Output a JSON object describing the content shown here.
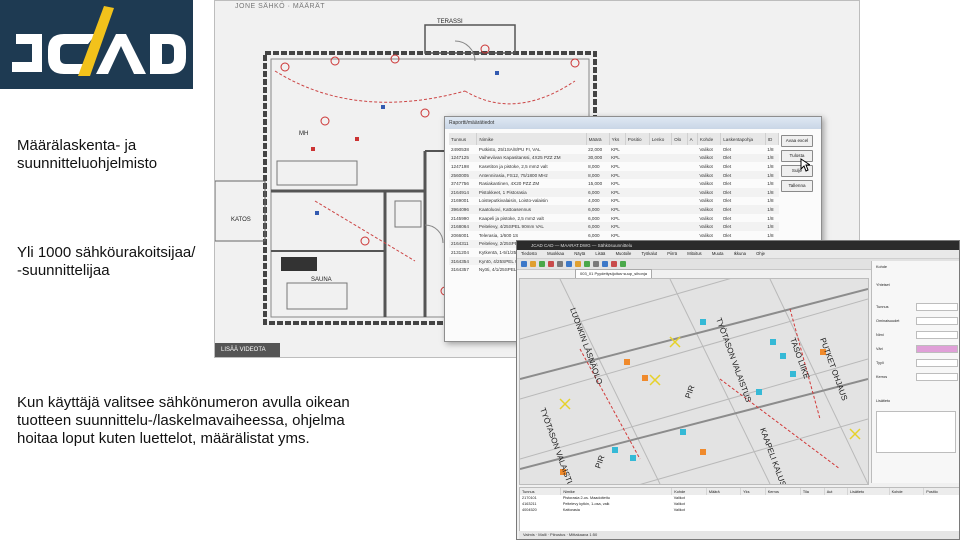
{
  "logo": {
    "text": "JCAD",
    "bg_color": "#1e3a52",
    "fg_color": "#ffffff"
  },
  "texts": {
    "line1": "Määrälaskenta- ja",
    "line2": "suunnitteluohjelmisto",
    "line3": "Yli 1000 sähköurakoitsijaa/",
    "line4": "-suunnittelijaa",
    "line5": "Kun käyttäjä valitsee sähkönumeron avulla oikean",
    "line6": "tuotteen suunnittelu-/laskelmavaiheessa, ohjelma",
    "line7": "hoitaa loput kuten luettelot, määrälistat yms."
  },
  "plan": {
    "title": "JONE SÄHKÖ · MÄÄRÄT",
    "rooms": [
      "TERASSI",
      "MH",
      "KATOS",
      "SAUNA"
    ],
    "bottom_label": "LISÄÄ VIDEOTA"
  },
  "report": {
    "title": "Raportti/määrätiedot",
    "columns": [
      "Tunnus",
      "Nimike",
      "Määrä",
      "Yks",
      "Positio",
      "Lenko",
      "Olo",
      "A",
      "Kohde",
      "Laskentapohja",
      "ID"
    ],
    "rows": [
      [
        "2490538",
        "Putkisto, 25/1SA/8/PU FI, VAL",
        "22,000",
        "KPL",
        "Valikot",
        "Olet",
        "1/8"
      ],
      [
        "1247125",
        "Vaiheviivan Kapasitanssi, 4X25 PZZ ZM",
        "30,000",
        "KPL",
        "Valikot",
        "Olet",
        "1/8"
      ],
      [
        "1247198",
        "Kasetiton ja pistoke, 2,5 mm2 valt",
        "8,000",
        "KPL",
        "Valikot",
        "Olet",
        "1/8"
      ],
      [
        "2560005",
        "Antennirasia, FS12, 75/1800 MHz",
        "8,000",
        "KPL",
        "Valikot",
        "Olet",
        "1/8"
      ],
      [
        "3747756",
        "Rasiakantinen, 4X20 PZZ ZM",
        "15,000",
        "KPL",
        "Valikot",
        "Olet",
        "1/8"
      ],
      [
        "2164914",
        "Pistokkeet, 1 Pistorasia",
        "6,000",
        "KPL",
        "Valikot",
        "Olet",
        "1/8"
      ],
      [
        "2169001",
        "Loisteputkivalaisin, Loisto-valaisin",
        "4,000",
        "KPL",
        "Valikot",
        "Olet",
        "1/8"
      ],
      [
        "3964096",
        "Kaatoluovi, Kattoasennus",
        "6,000",
        "KPL",
        "Valikot",
        "Olet",
        "1/8"
      ],
      [
        "2145990",
        "Kaapeli ja pistoke, 2,5 mm2 valt",
        "6,000",
        "KPL",
        "Valikot",
        "Olet",
        "1/8"
      ],
      [
        "2168064",
        "Peitelevy, 4/25SPEL 90mm VAL",
        "6,000",
        "KPL",
        "Valikot",
        "Olet",
        "1/8"
      ],
      [
        "2066001",
        "Telerasia, 1/600 1S",
        "6,000",
        "KPL",
        "Valikot",
        "Olet",
        "1/8"
      ],
      [
        "2164311",
        "Peitelevy, 2/25SPEL 90mm VAL",
        "6,000",
        "KPL",
        "Valikot",
        "Olet",
        "1/8"
      ],
      [
        "2131204",
        "Kytkentä, 1-5/1/25, Ver V-1",
        "7,000",
        "KPL",
        "Valikot",
        "Olet",
        "1/8"
      ],
      [
        "3164354",
        "Kyntö, 4/25SPEL 90 AS",
        "8,000",
        "KPL",
        "Valikot",
        "Olet",
        "1/8"
      ],
      [
        "3164357",
        "Nyöti, 4/1/25SPEL PKL",
        "8,000",
        "KPL",
        "Valikot",
        "Olet",
        "1/8"
      ]
    ],
    "buttons": [
      "Avaa excel",
      "Tulosta",
      "Sulje",
      "Tallenna"
    ]
  },
  "cad": {
    "title": "JCAD CAD — MAARAT.DWG — Sähkösuunnittelu",
    "menu": [
      "Tiedosto",
      "Muokkaa",
      "Näytä",
      "Lisää",
      "Muotoile",
      "Työkalut",
      "Piirrä",
      "Mitoitus",
      "Muuta",
      "Ikkuna",
      "Ohje"
    ],
    "tab": "003_01 Pyydettysijoitus·suup_sihonja",
    "canvas_labels": [
      "TYÖTASON VALAISTUS",
      "LUONKIN LÄSNÄOLO",
      "PIR",
      "PIR",
      "TYÖTASON VALAISTUS",
      "KAAPELI KALUSTE",
      "PUTKET OHJAUS",
      "TASO LIIKE"
    ],
    "props": [
      "Kohde",
      "Yhteiset",
      "Tunnus",
      "Ominaisuudet",
      "Nimi",
      "Väri",
      "Tyyli",
      "Kerros",
      "Lisätieto"
    ],
    "bottom_columns": [
      "Tunnus",
      "Nimike",
      "Kohde",
      "Määrä",
      "Yks",
      "Kerros",
      "Tila",
      "Aut",
      "Lisätieto",
      "Kohde",
      "Positio"
    ],
    "bottom_rows": [
      [
        "2170101",
        "Pistorasia 2-os. Maadoitettu",
        "Valikot"
      ],
      [
        "4163211",
        "Peitelevy kytkin, 1-osa, valk",
        "Valikot"
      ],
      [
        "4004520",
        "Kattorasia",
        "Valikot"
      ]
    ],
    "status": "Valmis · Malli · Piirustus · Mittakaava 1:50"
  }
}
